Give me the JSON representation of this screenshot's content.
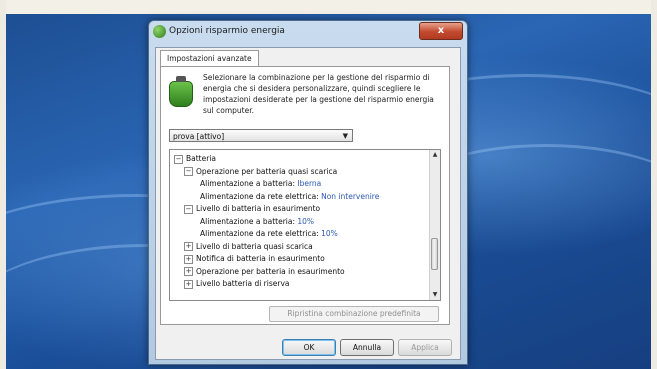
{
  "window": {
    "title": "Opzioni risparmio energia",
    "close_label": "x"
  },
  "tab": {
    "label": "Impostazioni avanzate"
  },
  "description": "Selezionare la combinazione per la gestione del risparmio di energia che si desidera personalizzare, quindi scegliere le impostazioni desiderate per la gestione del risparmio energia sul computer.",
  "plan_select": {
    "value": "prova [attivo]"
  },
  "tree": {
    "rows": [
      {
        "toggle": "−",
        "label": "Batteria",
        "value": ""
      },
      {
        "toggle": "−",
        "label": "Operazione per batteria quasi scarica",
        "value": ""
      },
      {
        "toggle": "",
        "label": "Alimentazione a batteria:",
        "value": "Iberna"
      },
      {
        "toggle": "",
        "label": "Alimentazione da rete elettrica:",
        "value": "Non intervenire"
      },
      {
        "toggle": "−",
        "label": "Livello di batteria in esaurimento",
        "value": ""
      },
      {
        "toggle": "",
        "label": "Alimentazione a batteria:",
        "value": "10%"
      },
      {
        "toggle": "",
        "label": "Alimentazione da rete elettrica:",
        "value": "10%"
      },
      {
        "toggle": "+",
        "label": "Livello di batteria quasi scarica",
        "value": ""
      },
      {
        "toggle": "+",
        "label": "Notifica di batteria in esaurimento",
        "value": ""
      },
      {
        "toggle": "+",
        "label": "Operazione per batteria in esaurimento",
        "value": ""
      },
      {
        "toggle": "+",
        "label": "Livello batteria di riserva",
        "value": ""
      }
    ]
  },
  "buttons": {
    "reset": "Ripristina combinazione predefinita",
    "ok": "OK",
    "cancel": "Annulla",
    "apply": "Applica"
  },
  "colors": {
    "accent": "#2a58b4",
    "desktop": "#1f5aa6"
  }
}
